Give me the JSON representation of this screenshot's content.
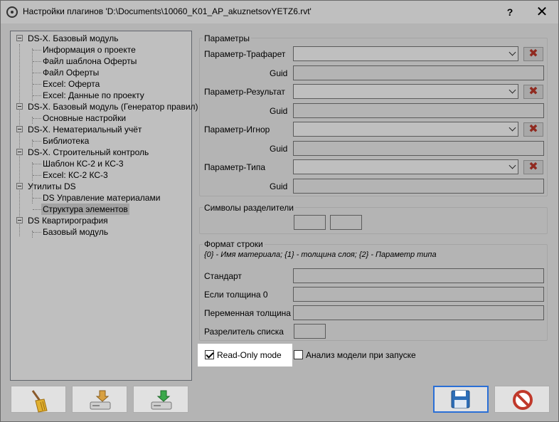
{
  "window": {
    "title": "Настройки плагинов 'D:\\Documents\\10060_K01_AP_akuznetsovYETZ6.rvt'",
    "help_label": "?",
    "close_label": "✕"
  },
  "tree": {
    "items": [
      {
        "label": "DS-X. Базовый модуль",
        "level": 0
      },
      {
        "label": "Информация о проекте",
        "level": 1
      },
      {
        "label": "Файл шаблона Оферты",
        "level": 1
      },
      {
        "label": "Файл Оферты",
        "level": 1
      },
      {
        "label": "Excel: Оферта",
        "level": 1
      },
      {
        "label": "Excel: Данные по проекту",
        "level": 1
      },
      {
        "label": "DS-X. Базовый модуль (Генератор правил)",
        "level": 0
      },
      {
        "label": "Основные настройки",
        "level": 1
      },
      {
        "label": "DS-X. Нематериальный учёт",
        "level": 0
      },
      {
        "label": "Библиотека",
        "level": 1
      },
      {
        "label": "DS-X. Строительный контроль",
        "level": 0
      },
      {
        "label": "Шаблон КС-2 и КС-3",
        "level": 1
      },
      {
        "label": "Excel: КС-2 КС-3",
        "level": 1
      },
      {
        "label": "Утилиты DS",
        "level": 0
      },
      {
        "label": "DS Управление материалами",
        "level": 1
      },
      {
        "label": "Структура элементов",
        "level": 1,
        "selected": true
      },
      {
        "label": "DS Квартирография",
        "level": 0
      },
      {
        "label": "Базовый модуль",
        "level": 1
      }
    ]
  },
  "params": {
    "title": "Параметры",
    "rows": [
      {
        "label": "Параметр-Трафарет",
        "guid_label": "Guid"
      },
      {
        "label": "Параметр-Результат",
        "guid_label": "Guid"
      },
      {
        "label": "Параметр-Игнор",
        "guid_label": "Guid"
      },
      {
        "label": "Параметр-Типа",
        "guid_label": "Guid"
      }
    ]
  },
  "separators": {
    "title": "Символы разделители"
  },
  "format": {
    "title": "Формат строки",
    "hint": "{0} - Имя материала; {1} - толщина слоя; {2} - Параметр типа",
    "standard_label": "Стандарт",
    "if_zero_label": "Если толщина 0",
    "variable_label": "Переменная толщина",
    "list_sep_label": "Разрелитель списка"
  },
  "options": {
    "readonly_label": "Read-Only mode",
    "readonly_checked": true,
    "analyze_label": "Анализ модели при запуске",
    "analyze_checked": false
  },
  "colors": {
    "accent": "#2a6fd6",
    "delete": "#c0392b"
  },
  "icons": {
    "clean": "broom-icon",
    "import": "import-drive-icon",
    "export": "export-drive-icon",
    "save": "floppy-disk-icon",
    "cancel": "cancel-icon"
  }
}
